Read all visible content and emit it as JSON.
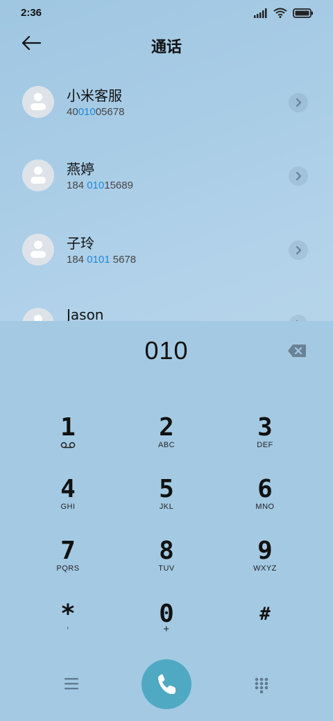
{
  "status": {
    "time": "2:36"
  },
  "header": {
    "title": "通话"
  },
  "contacts": [
    {
      "name": "小米客服",
      "number_pre": "40",
      "number_hl": "010",
      "number_post": "05678"
    },
    {
      "name": "燕婷",
      "number_pre": "184 ",
      "number_hl": "010",
      "number_post": "15689"
    },
    {
      "name": "子玲",
      "number_pre": "184 ",
      "number_hl": "0101",
      "number_post": " 5678"
    },
    {
      "name": "Jason",
      "number_pre": "",
      "number_hl": "",
      "number_post": ""
    }
  ],
  "dialer": {
    "input": "010",
    "keys": [
      {
        "digit": "1",
        "letters": ""
      },
      {
        "digit": "2",
        "letters": "ABC"
      },
      {
        "digit": "3",
        "letters": "DEF"
      },
      {
        "digit": "4",
        "letters": "GHI"
      },
      {
        "digit": "5",
        "letters": "JKL"
      },
      {
        "digit": "6",
        "letters": "MNO"
      },
      {
        "digit": "7",
        "letters": "PQRS"
      },
      {
        "digit": "8",
        "letters": "TUV"
      },
      {
        "digit": "9",
        "letters": "WXYZ"
      },
      {
        "digit": "*",
        "letters": ","
      },
      {
        "digit": "0",
        "letters": "+"
      },
      {
        "digit": "#",
        "letters": ""
      }
    ]
  },
  "icons": {
    "back": "back-arrow-icon",
    "detail": "chevron-right-icon",
    "backspace": "backspace-icon",
    "voicemail": "voicemail-icon",
    "menu": "menu-icon",
    "call": "phone-icon",
    "keypad": "dialpad-icon"
  },
  "colors": {
    "highlight": "#1e88d8",
    "call_button": "#4fa9c3",
    "dial_panel": "#a4c9e3"
  }
}
